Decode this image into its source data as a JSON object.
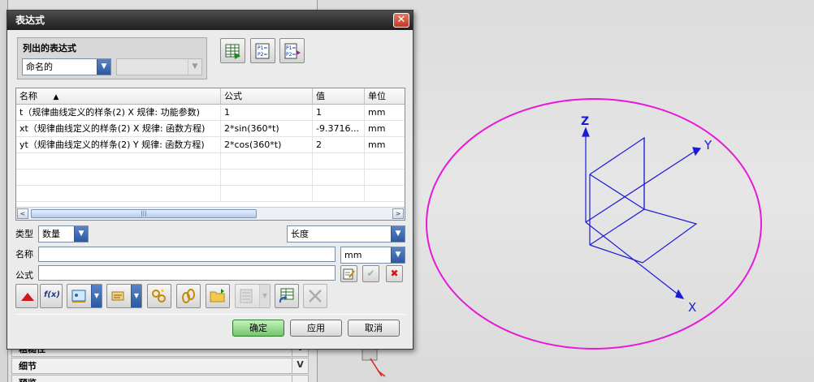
{
  "dialog": {
    "title": "表达式",
    "close_glyph": "✕",
    "list_group": {
      "label": "列出的表达式",
      "filter_value": "命名的",
      "secondary_value": ""
    },
    "table": {
      "headers": [
        "名称",
        "公式",
        "值",
        "单位"
      ],
      "sort_glyph": "▲",
      "rows": [
        {
          "name": "t（规律曲线定义的样条(2) X 规律: 功能参数)",
          "formula": "1",
          "value": "1",
          "unit": "mm"
        },
        {
          "name": "xt（规律曲线定义的样条(2) X 规律: 函数方程)",
          "formula": "2*sin(360*t)",
          "value": "-9.3716...",
          "unit": "mm"
        },
        {
          "name": "yt（规律曲线定义的样条(2) Y 规律: 函数方程)",
          "formula": "2*cos(360*t)",
          "value": "2",
          "unit": "mm"
        }
      ],
      "scroll_left": "<",
      "scroll_right": ">",
      "scroll_grip": "|||"
    },
    "type_label": "类型",
    "type_value": "数量",
    "dimension_value": "长度",
    "name_label": "名称",
    "name_value": "",
    "unit_value": "mm",
    "formula_label": "公式",
    "formula_value": "",
    "fx_label": "f(x)",
    "ok_label": "确定",
    "apply_label": "应用",
    "cancel_label": "取消"
  },
  "background": {
    "panel_rows": [
      "粗糙性",
      "细节",
      "预览"
    ],
    "chevron": "V"
  },
  "viewport": {
    "axis_labels": {
      "z": "Z",
      "y": "Y",
      "x": "X"
    },
    "ellipse_color": "#e619d8",
    "axes_color": "#1a1ad6"
  },
  "icons": {
    "toolbar": [
      "spreadsheet-icon",
      "list-p1-p2-icon",
      "export-p1-p2-icon"
    ],
    "bottom": [
      "triangle-up-icon",
      "function-icon",
      "measure-icon",
      "pencil-icon",
      "link-icon",
      "chain-icon",
      "folder-icon",
      "list-icon",
      "spreadsheet-refresh-icon",
      "delete-icon"
    ]
  },
  "colors": {
    "title_bar": "#2a2a2a",
    "close": "#c0392b",
    "ok_button": "#73c66a",
    "combo_drop": "#2c59a5"
  }
}
